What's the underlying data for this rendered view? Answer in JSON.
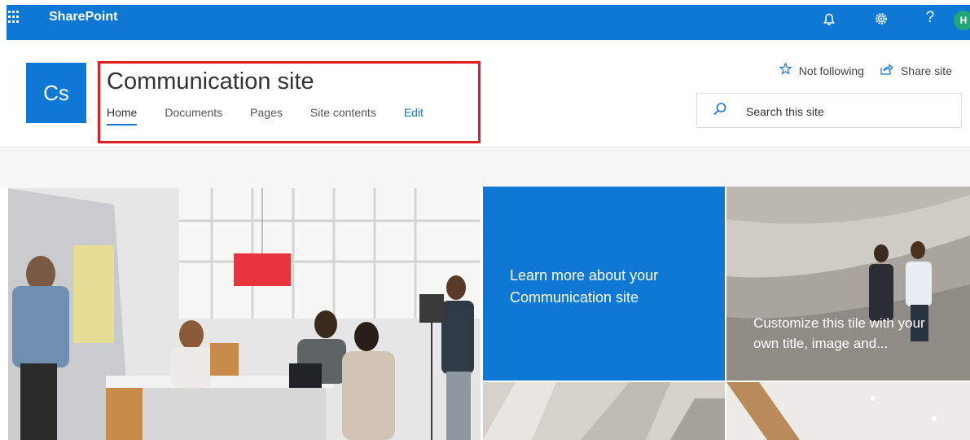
{
  "suite_bar": {
    "app_name": "SharePoint",
    "notifications_icon": "bell-icon",
    "settings_icon": "gear-icon",
    "help_label": "?",
    "avatar_initial": "H",
    "accent_color": "#0f78d4"
  },
  "site": {
    "logo_text": "Cs",
    "title": "Communication site",
    "nav": [
      {
        "label": "Home",
        "active": true
      },
      {
        "label": "Documents"
      },
      {
        "label": "Pages"
      },
      {
        "label": "Site contents"
      },
      {
        "label": "Edit"
      }
    ],
    "follow_label": "Not following",
    "follow_icon": "star-icon",
    "share_label": "Share site",
    "share_icon": "share-icon",
    "search_placeholder": "Search this site",
    "search_icon": "search-icon",
    "highlight_color": "#e31c24"
  },
  "tiles": [
    {
      "kind": "image",
      "description_icon": "meeting-photo"
    },
    {
      "kind": "text",
      "text": "Learn more about your Communication site"
    },
    {
      "kind": "image-text",
      "text": "Customize this tile with your own title, image and..."
    },
    {
      "kind": "image"
    },
    {
      "kind": "image"
    }
  ]
}
